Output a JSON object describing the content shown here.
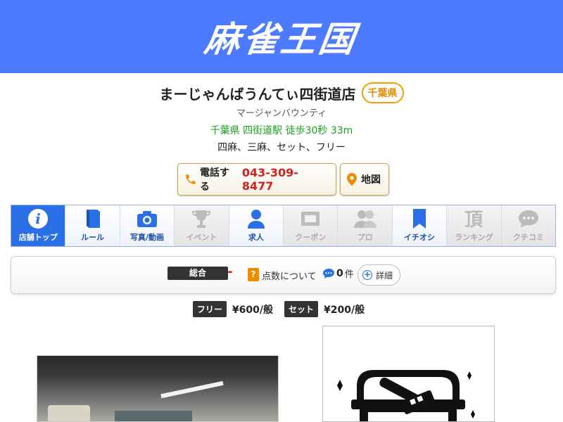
{
  "header": {
    "logo": "麻雀王国"
  },
  "shop": {
    "name": "まーじゃんばうんてぃ四街道店",
    "prefecture_badge": "千葉県",
    "kana": "マージャンバウンティ",
    "access": "千葉県 四街道駅 徒歩30秒 33m",
    "games": "四麻、三麻、セット、フリー"
  },
  "actions": {
    "phone_label": "電話する",
    "phone_number": "043-309-8477",
    "map_label": "地図"
  },
  "tabs": [
    {
      "label": "店舗トップ",
      "icon": "info-icon",
      "state": "active"
    },
    {
      "label": "ルール",
      "icon": "book-icon",
      "state": "enabled"
    },
    {
      "label": "写真/動画",
      "icon": "camera-icon",
      "state": "enabled"
    },
    {
      "label": "イベント",
      "icon": "trophy-icon",
      "state": "disabled"
    },
    {
      "label": "求人",
      "icon": "person-icon",
      "state": "enabled"
    },
    {
      "label": "クーポン",
      "icon": "ticket-icon",
      "state": "disabled"
    },
    {
      "label": "プロ",
      "icon": "people-icon",
      "state": "disabled"
    },
    {
      "label": "イチオシ",
      "icon": "bookmark-icon",
      "state": "enabled"
    },
    {
      "label": "ランキング",
      "icon": "crown-kanji-icon",
      "state": "disabled"
    },
    {
      "label": "クチコミ",
      "icon": "chat-bubble-icon",
      "state": "disabled"
    }
  ],
  "score": {
    "overall_label": "総合",
    "overall_value": "-",
    "help_mark": "?",
    "about_label": "点数について",
    "comment_count": "0",
    "comment_unit": "件",
    "detail_label": "詳細"
  },
  "prices": [
    {
      "tag": "フリー",
      "value": "¥600/般"
    },
    {
      "tag": "セット",
      "value": "¥200/般"
    }
  ],
  "colors": {
    "header_blue": "#4d7bff",
    "tab_active": "#2b6fe6",
    "tab_text": "#1d4ea8",
    "phone_red": "#d61f1f",
    "access_green": "#1a9e1a",
    "badge_orange": "#f5a000"
  }
}
